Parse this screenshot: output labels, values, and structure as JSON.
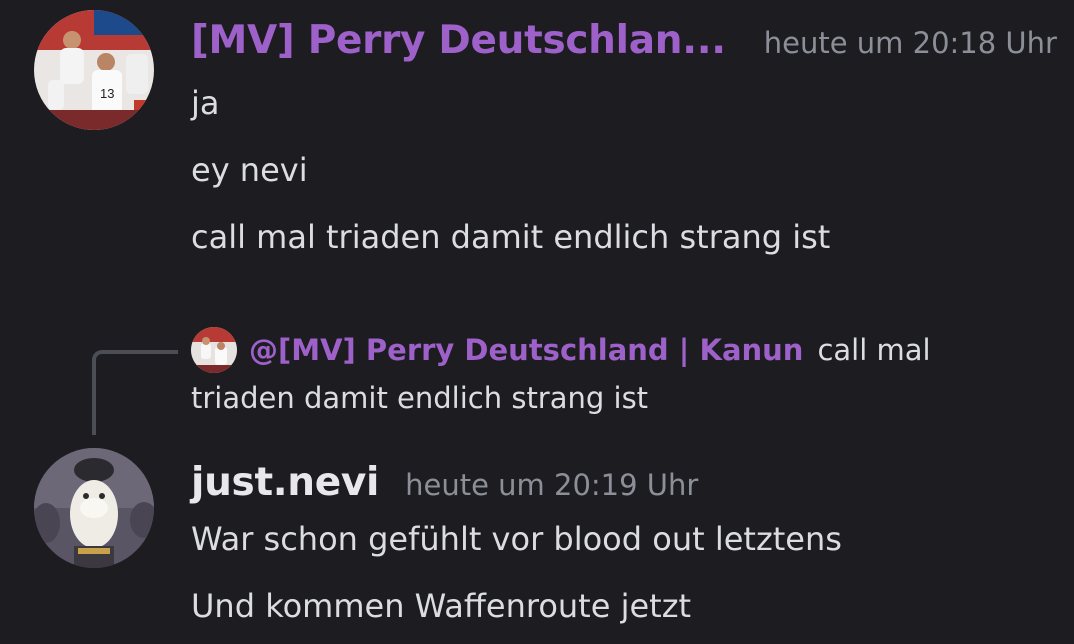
{
  "messages": [
    {
      "author": "[MV] Perry Deutschlan...",
      "timestamp": "heute um 20:18 Uhr",
      "lines": [
        "ja",
        "ey nevi",
        "call mal triaden damit endlich strang ist"
      ]
    },
    {
      "reply": {
        "mention": "@[MV] Perry Deutschland | Kanun",
        "text_line1": "call mal",
        "text_line2": "triaden damit endlich strang ist"
      },
      "author": "just.nevi",
      "timestamp": "heute um 20:19 Uhr",
      "lines": [
        "War schon gefühlt vor blood out letztens",
        "Und kommen Waffenroute jetzt"
      ]
    }
  ],
  "colors": {
    "background": "#1c1c21",
    "mention_purple": "#9d61c9",
    "text": "#dcdde1",
    "timestamp": "#8c8f98"
  },
  "icons": {
    "avatar_1": "football-players-avatar",
    "avatar_2": "person-face-avatar",
    "reply_avatar": "football-players-mini-avatar"
  }
}
